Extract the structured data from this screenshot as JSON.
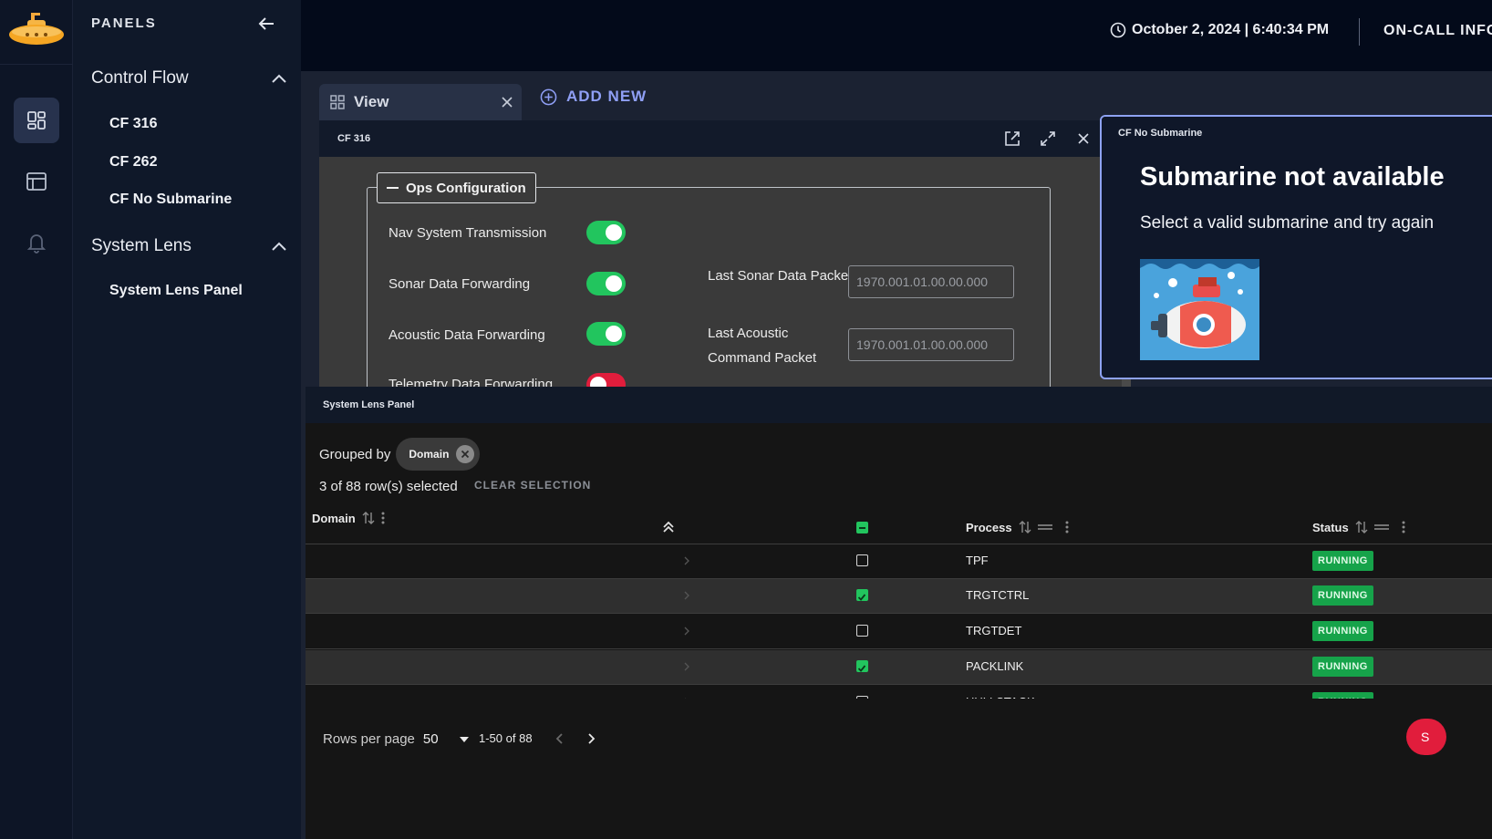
{
  "rail": {
    "icons": [
      "submarine-logo",
      "panels-icon",
      "layout-icon",
      "bell-icon"
    ]
  },
  "panels": {
    "title": "PANELS",
    "sections": [
      {
        "label": "Control Flow",
        "items": [
          "CF 316",
          "CF 262",
          "CF No Submarine"
        ]
      },
      {
        "label": "System Lens",
        "items": [
          "System Lens Panel"
        ]
      }
    ]
  },
  "topbar": {
    "datetime": "October 2, 2024 | 6:40:34 PM",
    "oncall": "ON-CALL INFO"
  },
  "tabs": {
    "view": "View",
    "add_new": "ADD NEW"
  },
  "cf316": {
    "title": "CF 316",
    "legend": "Ops Configuration",
    "rows": [
      {
        "label": "Nav System Transmission",
        "on": true
      },
      {
        "label": "Sonar Data Forwarding",
        "on": true
      },
      {
        "label": "Acoustic Data Forwarding",
        "on": true
      },
      {
        "label": "Telemetry Data Forwarding",
        "on": false
      }
    ],
    "fields": [
      {
        "label": "Last Sonar Data Packet",
        "value": "1970.001.01.00.00.000"
      },
      {
        "label": "Last Acoustic Command Packet",
        "value": "1970.001.01.00.00.000"
      }
    ]
  },
  "nosub": {
    "title": "CF No Submarine",
    "heading": "Submarine not available",
    "message": "Select a valid submarine and try again"
  },
  "syslens": {
    "title": "System Lens Panel",
    "grouped_label": "Grouped by",
    "chip": "Domain",
    "selection": "3 of 88 row(s) selected",
    "clear": "CLEAR SELECTION",
    "columns": {
      "domain": "Domain",
      "process": "Process",
      "status": "Status"
    },
    "rows": [
      {
        "process": "TPF",
        "status": "RUNNING",
        "selected": false
      },
      {
        "process": "TRGTCTRL",
        "status": "RUNNING",
        "selected": true
      },
      {
        "process": "TRGTDET",
        "status": "RUNNING",
        "selected": false
      },
      {
        "process": "PACKLINK",
        "status": "RUNNING",
        "selected": true
      },
      {
        "process": "HULLSTACK",
        "status": "RUNNING",
        "selected": false
      }
    ],
    "rows_per_page_label": "Rows per page",
    "rows_per_page": "50",
    "range": "1-50 of 88",
    "fab": "S"
  },
  "colors": {
    "accent": "#8f9ff5",
    "running": "#16a34a",
    "toggle_on": "#22c55e",
    "toggle_off": "#e11d3c"
  }
}
